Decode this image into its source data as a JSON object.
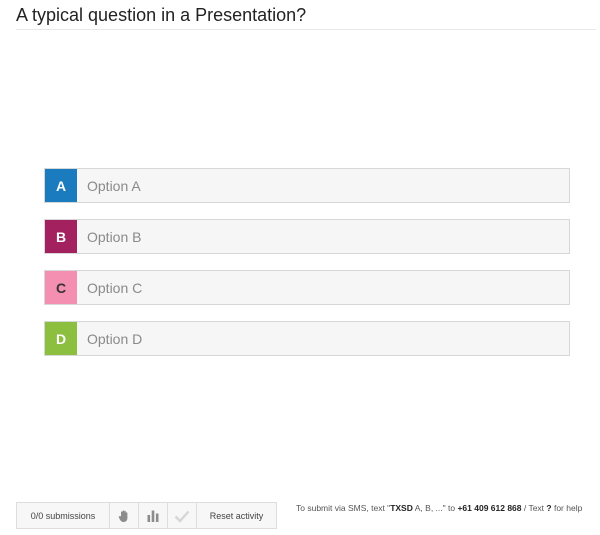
{
  "question": {
    "title": "A typical question in a Presentation?"
  },
  "options": [
    {
      "letter": "A",
      "label": "Option A",
      "color": "#1a7bbf"
    },
    {
      "letter": "B",
      "label": "Option B",
      "color": "#a3215e"
    },
    {
      "letter": "C",
      "label": "Option C",
      "color": "#f48fb1"
    },
    {
      "letter": "D",
      "label": "Option D",
      "color": "#8cbf3f"
    }
  ],
  "footer": {
    "submissions": "0/0 submissions",
    "raise_hand_icon": "hand-icon",
    "results_icon": "bar-chart-icon",
    "correct_icon": "checkmark-icon",
    "reset_label": "Reset activity"
  },
  "sms": {
    "prefix": "To submit via SMS, text \"",
    "code": "TXSD",
    "mid": " A, B, ...\" to ",
    "number": "+61 409 612 868",
    "slash": " / Text ",
    "help_char": "?",
    "suffix": " for help"
  }
}
